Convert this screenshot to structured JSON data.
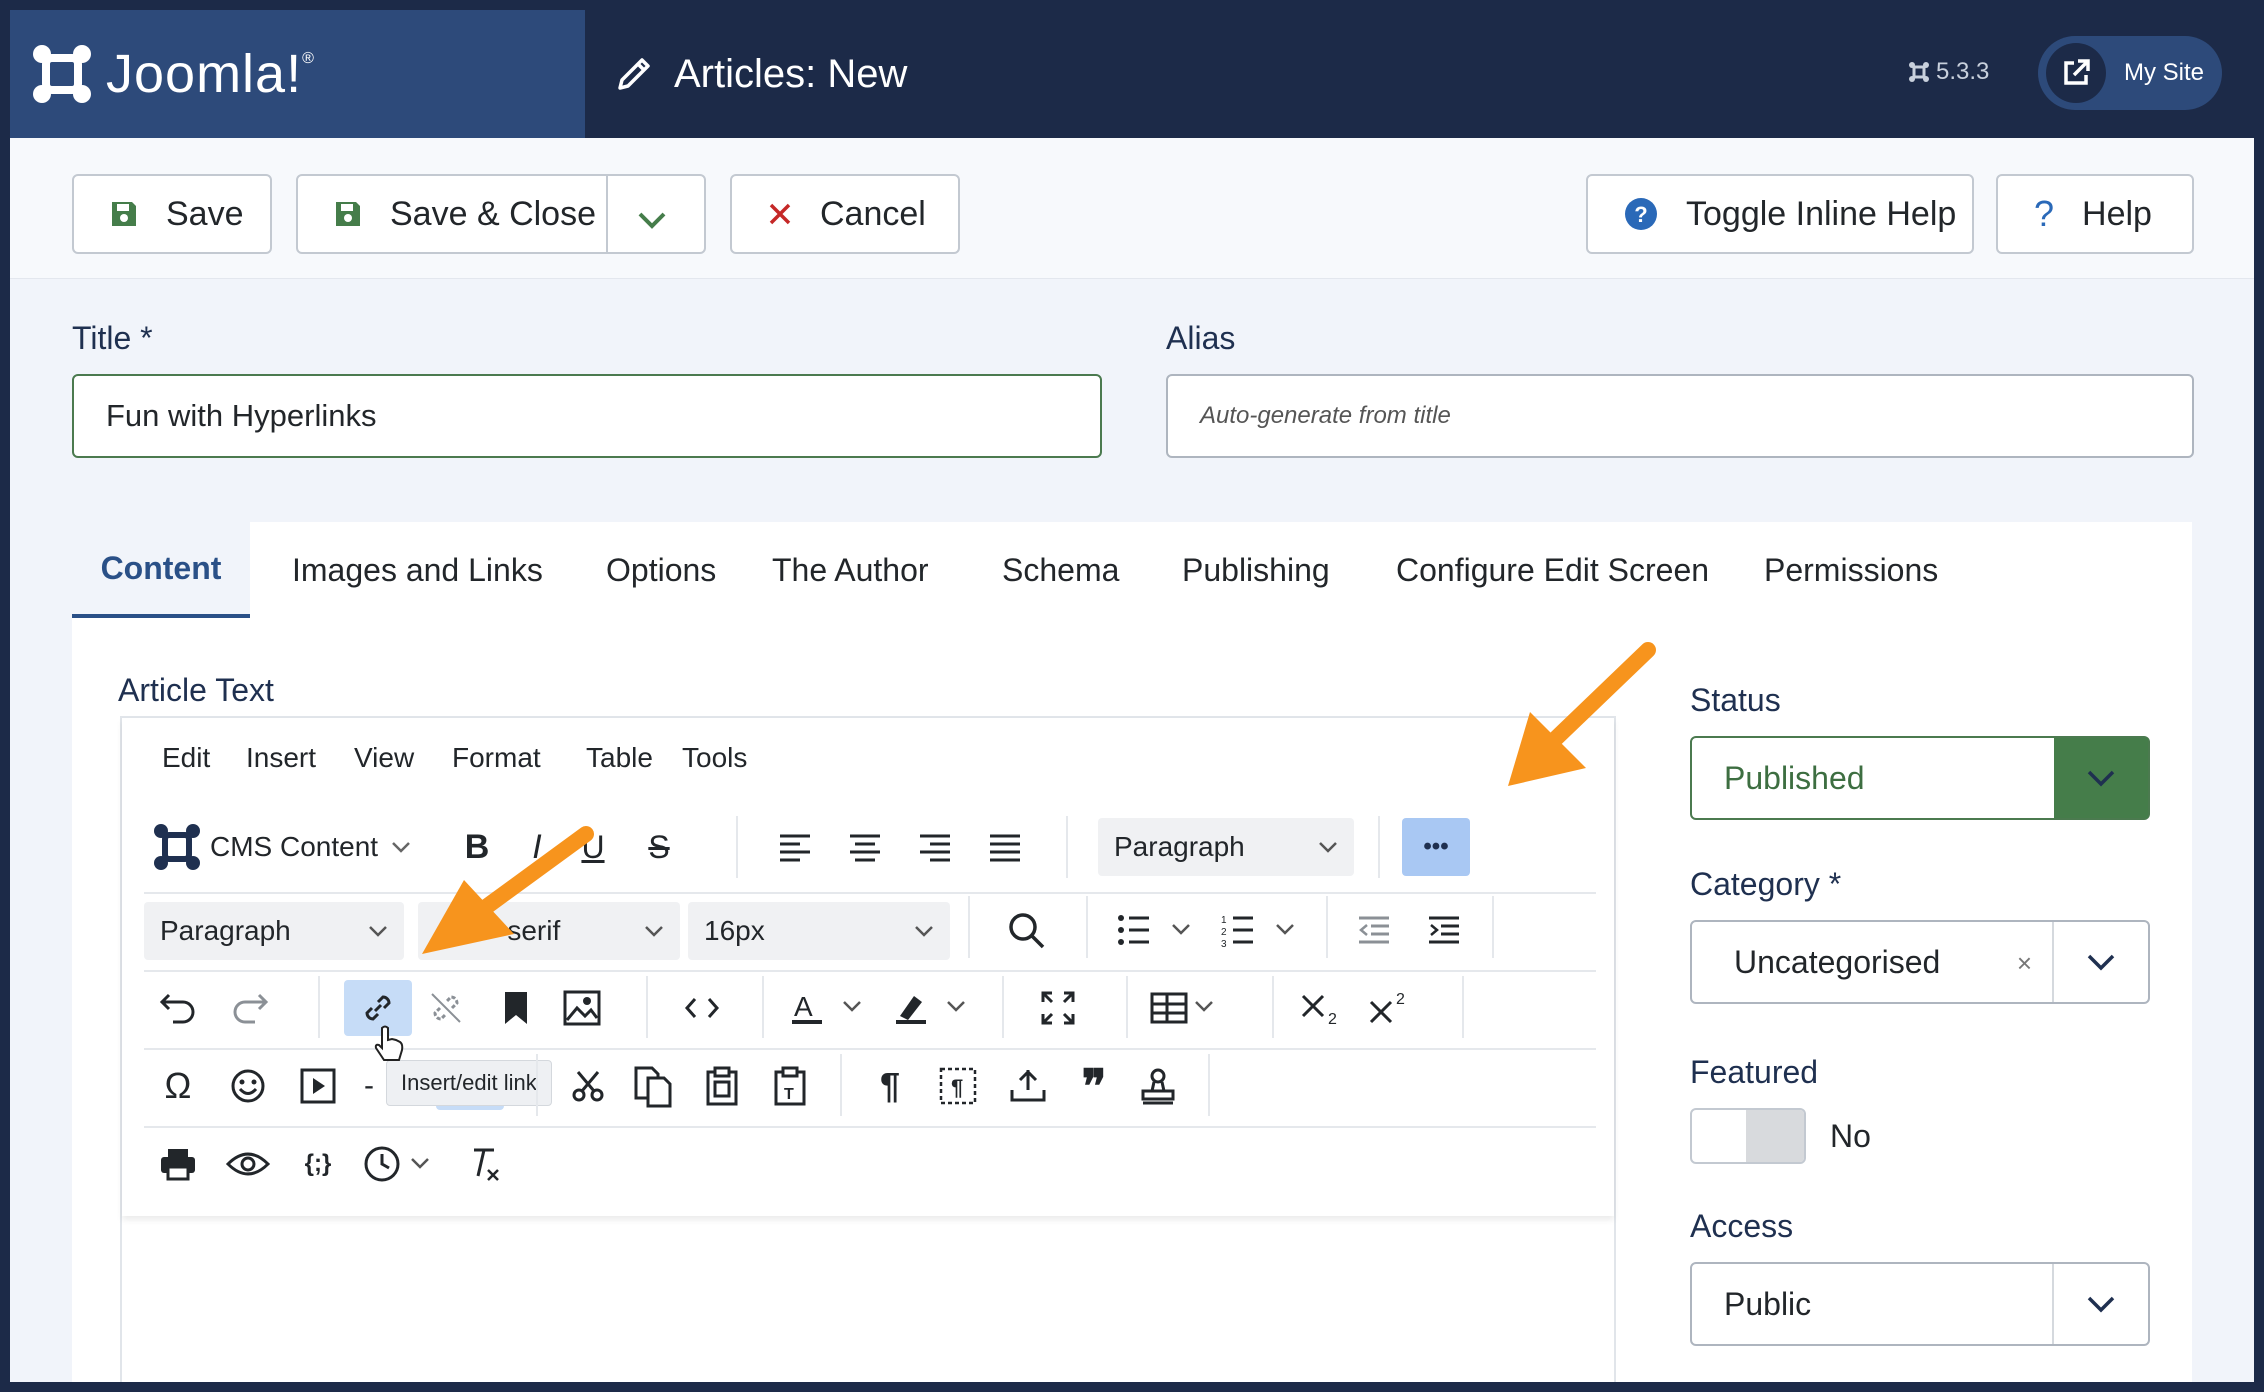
{
  "header": {
    "logo_text": "Joomla!",
    "logo_mark": "®",
    "page_title": "Articles: New",
    "version": "5.3.3",
    "my_site_label": "My Site"
  },
  "toolbar": {
    "save_label": "Save",
    "save_close_label": "Save & Close",
    "cancel_label": "Cancel",
    "toggle_help_label": "Toggle Inline Help",
    "help_label": "Help"
  },
  "form": {
    "title_label": "Title *",
    "title_value": "Fun with Hyperlinks",
    "alias_label": "Alias",
    "alias_placeholder": "Auto-generate from title"
  },
  "tabs": [
    "Content",
    "Images and Links",
    "Options",
    "The Author",
    "Schema",
    "Publishing",
    "Configure Edit Screen",
    "Permissions"
  ],
  "editor": {
    "section_label": "Article Text",
    "menus": [
      "Edit",
      "Insert",
      "View",
      "Format",
      "Table",
      "Tools"
    ],
    "cms_content_label": "CMS Content",
    "block_format_1": "Paragraph",
    "block_format_2": "Paragraph",
    "font_family_visible": "-serif",
    "font_size": "16px",
    "more_label": "•••",
    "tooltip": "Insert/edit link"
  },
  "sidebar": {
    "status_label": "Status",
    "status_value": "Published",
    "category_label": "Category *",
    "category_value": "Uncategorised",
    "featured_label": "Featured",
    "featured_value": "No",
    "access_label": "Access",
    "access_value": "Public"
  },
  "colors": {
    "header_bg": "#1c2a48",
    "logo_bg": "#2d4a7a",
    "save_green": "#457d4a",
    "cancel_red": "#c52827",
    "help_blue": "#2a69b8",
    "annotation_orange": "#f7941d",
    "active_tool": "#c6dcf7"
  }
}
